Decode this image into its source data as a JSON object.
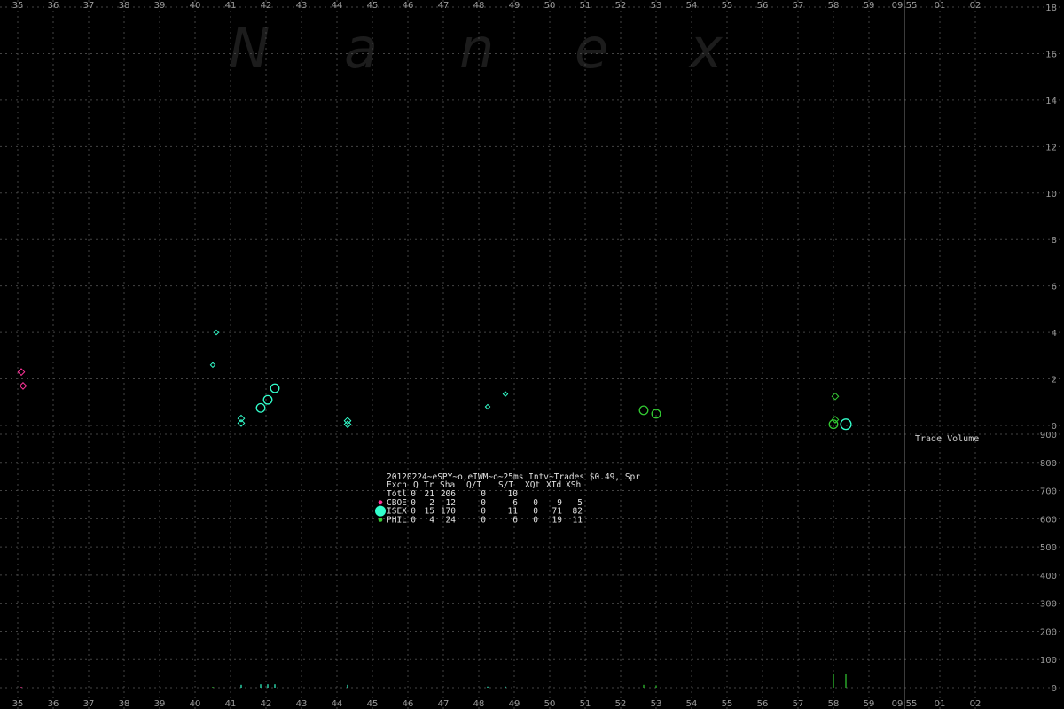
{
  "watermark": [
    "N",
    "a",
    "n",
    "e",
    "x"
  ],
  "chart_data": {
    "type": "scatter",
    "x_ticks": [
      "35",
      "36",
      "37",
      "38",
      "39",
      "40",
      "41",
      "42",
      "43",
      "44",
      "45",
      "46",
      "47",
      "48",
      "49",
      "50",
      "51",
      "52",
      "53",
      "54",
      "55",
      "56",
      "57",
      "58",
      "59",
      "09:55",
      "01",
      "02"
    ],
    "price_axis": {
      "ylim": [
        0,
        18
      ],
      "ticks": [
        0,
        2,
        4,
        6,
        8,
        10,
        12,
        14,
        16,
        18
      ]
    },
    "volume_axis": {
      "ylim": [
        0,
        900
      ],
      "ticks": [
        0,
        100,
        200,
        300,
        400,
        500,
        600,
        700,
        800,
        900
      ],
      "label": "Trade Volume"
    },
    "colors": {
      "CBOE": "#ff3399",
      "ISEX": "#33ffcc",
      "PHIL": "#33cc33"
    },
    "trades": [
      {
        "exch": "CBOE",
        "x": 35.1,
        "y": 2.3,
        "size": 2
      },
      {
        "exch": "CBOE",
        "x": 35.15,
        "y": 1.7,
        "size": 2
      },
      {
        "exch": "ISEX",
        "x": 40.6,
        "y": 4.0,
        "size": 1
      },
      {
        "exch": "ISEX",
        "x": 40.5,
        "y": 2.6,
        "size": 1
      },
      {
        "exch": "ISEX",
        "x": 41.3,
        "y": 0.3,
        "size": 2
      },
      {
        "exch": "ISEX",
        "x": 41.3,
        "y": 0.1,
        "size": 2
      },
      {
        "exch": "ISEX",
        "x": 41.85,
        "y": 0.75,
        "size": 3
      },
      {
        "exch": "ISEX",
        "x": 42.05,
        "y": 1.1,
        "size": 3
      },
      {
        "exch": "ISEX",
        "x": 42.25,
        "y": 1.6,
        "size": 3
      },
      {
        "exch": "ISEX",
        "x": 44.3,
        "y": 0.2,
        "size": 2
      },
      {
        "exch": "ISEX",
        "x": 44.3,
        "y": 0.05,
        "size": 2
      },
      {
        "exch": "ISEX",
        "x": 48.25,
        "y": 0.8,
        "size": 1
      },
      {
        "exch": "ISEX",
        "x": 48.75,
        "y": 1.35,
        "size": 1
      },
      {
        "exch": "PHIL",
        "x": 52.65,
        "y": 0.65,
        "size": 3
      },
      {
        "exch": "PHIL",
        "x": 53.0,
        "y": 0.5,
        "size": 3
      },
      {
        "exch": "PHIL",
        "x": 58.05,
        "y": 1.25,
        "size": 2
      },
      {
        "exch": "PHIL",
        "x": 58.05,
        "y": 0.25,
        "size": 2
      },
      {
        "exch": "PHIL",
        "x": 58.0,
        "y": 0.05,
        "size": 3
      },
      {
        "exch": "ISEX",
        "x": 58.35,
        "y": 0.05,
        "size": 4
      }
    ],
    "volume_bars": [
      {
        "exch": "CBOE",
        "x": 35.1,
        "v": 3
      },
      {
        "exch": "PHIL",
        "x": 40.5,
        "v": 3
      },
      {
        "exch": "ISEX",
        "x": 41.3,
        "v": 10
      },
      {
        "exch": "ISEX",
        "x": 41.85,
        "v": 12
      },
      {
        "exch": "ISEX",
        "x": 42.05,
        "v": 12
      },
      {
        "exch": "ISEX",
        "x": 42.25,
        "v": 12
      },
      {
        "exch": "ISEX",
        "x": 44.3,
        "v": 10
      },
      {
        "exch": "ISEX",
        "x": 48.25,
        "v": 4
      },
      {
        "exch": "ISEX",
        "x": 48.75,
        "v": 4
      },
      {
        "exch": "PHIL",
        "x": 52.65,
        "v": 10
      },
      {
        "exch": "PHIL",
        "x": 53.0,
        "v": 8
      },
      {
        "exch": "PHIL",
        "x": 58.0,
        "v": 50
      },
      {
        "exch": "PHIL",
        "x": 58.35,
        "v": 50
      }
    ],
    "legend": {
      "title": "20120224~eSPY~o,eIWM~o~25ms Intv~Trades $0.49, Spr",
      "header": [
        "Exch",
        "Q",
        "Tr",
        "Sha",
        "Q/T",
        "S/T",
        "XQt",
        "XTd",
        "XSh"
      ],
      "rows": [
        {
          "name": "Totl",
          "marker": "",
          "values": [
            "0",
            "21",
            "206",
            "0",
            "10",
            "",
            "",
            ""
          ]
        },
        {
          "name": "CBOE",
          "marker": "#ff3399",
          "values": [
            "0",
            "2",
            "12",
            "0",
            "6",
            "0",
            "9",
            "5"
          ]
        },
        {
          "name": "ISEX",
          "marker": "#33ffcc",
          "values": [
            "0",
            "15",
            "170",
            "0",
            "11",
            "0",
            "71",
            "82"
          ]
        },
        {
          "name": "PHIL",
          "marker": "#33cc33",
          "values": [
            "0",
            "4",
            "24",
            "0",
            "6",
            "0",
            "19",
            "11"
          ]
        }
      ]
    }
  }
}
